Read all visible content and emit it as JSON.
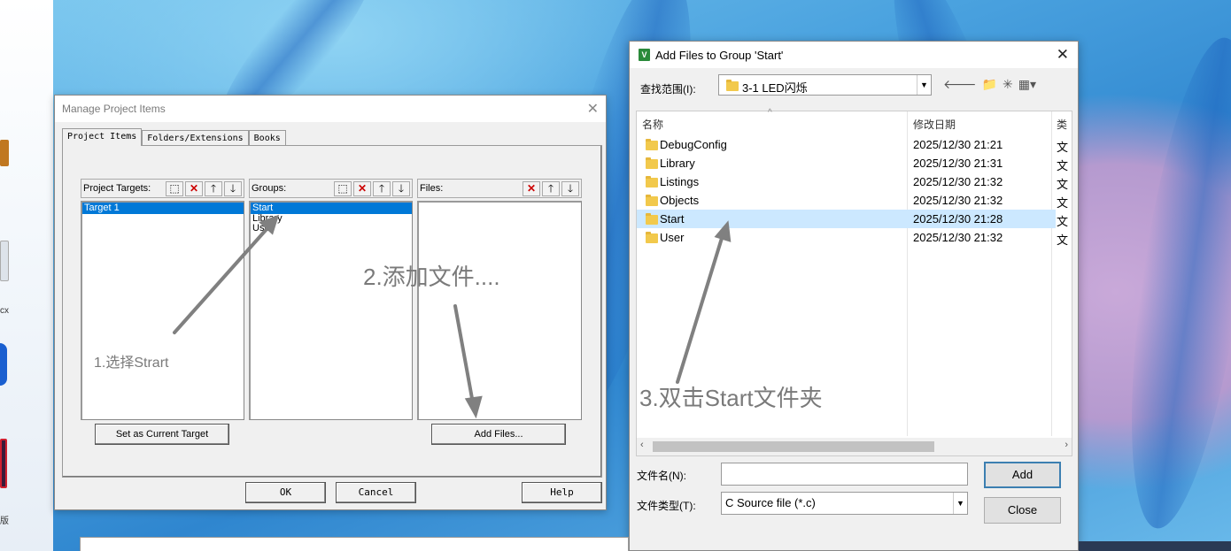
{
  "manage_dialog": {
    "title": "Manage Project Items",
    "tabs": [
      "Project Items",
      "Folders/Extensions",
      "Books"
    ],
    "targets_header": "Project Targets:",
    "targets": [
      "Target 1"
    ],
    "groups_header": "Groups:",
    "groups": [
      "Start",
      "Library",
      "User"
    ],
    "files_header": "Files:",
    "set_current_target_label": "Set as Current Target",
    "add_files_label": "Add Files...",
    "ok_label": "OK",
    "cancel_label": "Cancel",
    "help_label": "Help"
  },
  "add_files_dialog": {
    "title": "Add Files to Group 'Start'",
    "lookin_label": "查找范围(I):",
    "lookin_value": "3-1 LED闪烁",
    "columns": {
      "name": "名称",
      "date": "修改日期",
      "type": "类"
    },
    "rows": [
      {
        "name": "DebugConfig",
        "date": "2025/12/30 21:21",
        "type": "文"
      },
      {
        "name": "Library",
        "date": "2025/12/30 21:31",
        "type": "文"
      },
      {
        "name": "Listings",
        "date": "2025/12/30 21:32",
        "type": "文"
      },
      {
        "name": "Objects",
        "date": "2025/12/30 21:32",
        "type": "文"
      },
      {
        "name": "Start",
        "date": "2025/12/30 21:28",
        "type": "文"
      },
      {
        "name": "User",
        "date": "2025/12/30 21:32",
        "type": "文"
      }
    ],
    "filename_label": "文件名(N):",
    "filename_value": "",
    "filetype_label": "文件类型(T):",
    "filetype_value": "C Source file (*.c)",
    "add_label": "Add",
    "close_label": "Close"
  },
  "annotations": {
    "step1": "1.选择Strart",
    "step2": "2.添加文件....",
    "step3": "3.双击Start文件夹"
  },
  "desktop": {
    "label_a": "cx",
    "label_b": "版"
  }
}
